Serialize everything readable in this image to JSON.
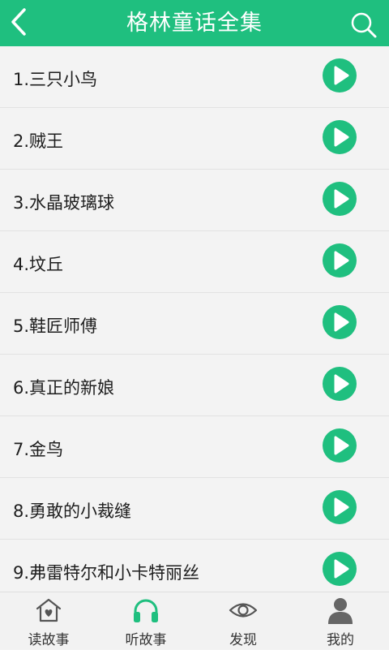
{
  "header": {
    "title": "格林童话全集",
    "back_icon": "chevron-left-icon",
    "search_icon": "search-icon",
    "bar_color": "#1fbf7f"
  },
  "stories": [
    {
      "label": "1.三只小鸟"
    },
    {
      "label": "2.贼王"
    },
    {
      "label": "3.水晶玻璃球"
    },
    {
      "label": "4.坟丘"
    },
    {
      "label": "5.鞋匠师傅"
    },
    {
      "label": "6.真正的新娘"
    },
    {
      "label": "7.金鸟"
    },
    {
      "label": "8.勇敢的小裁缝"
    },
    {
      "label": "9.弗雷特尔和小卡特丽丝"
    }
  ],
  "play_icon": "play-icon",
  "tabs": [
    {
      "label": "读故事",
      "icon": "house-heart-icon",
      "active": false
    },
    {
      "label": "听故事",
      "icon": "headphones-icon",
      "active": true
    },
    {
      "label": "发现",
      "icon": "eye-icon",
      "active": false
    },
    {
      "label": "我的",
      "icon": "user-icon",
      "active": false
    }
  ],
  "colors": {
    "accent": "#1fbf7f",
    "tab_inactive": "#555555"
  }
}
